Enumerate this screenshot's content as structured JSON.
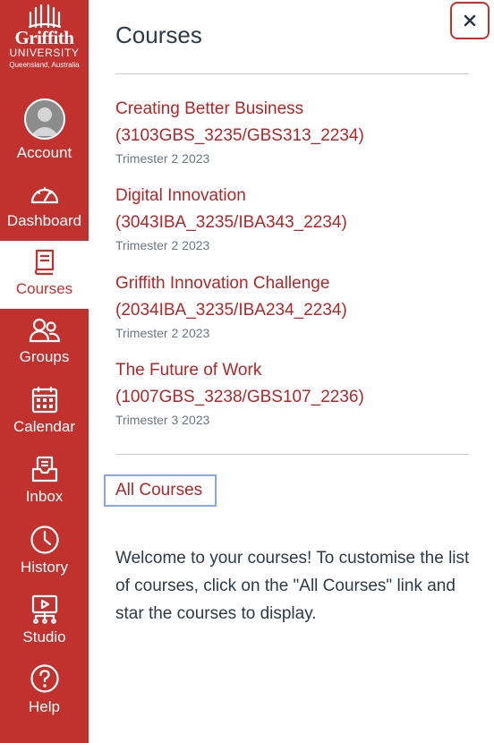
{
  "brand": {
    "name": "Griffith",
    "university": "UNIVERSITY",
    "location": "Queensland, Australia",
    "color": "#c1322f"
  },
  "nav": {
    "items": [
      {
        "id": "account",
        "label": "Account",
        "icon": "avatar",
        "active": false
      },
      {
        "id": "dashboard",
        "label": "Dashboard",
        "icon": "speedometer-icon",
        "active": false
      },
      {
        "id": "courses",
        "label": "Courses",
        "icon": "book-icon",
        "active": true
      },
      {
        "id": "groups",
        "label": "Groups",
        "icon": "people-icon",
        "active": false
      },
      {
        "id": "calendar",
        "label": "Calendar",
        "icon": "calendar-icon",
        "active": false
      },
      {
        "id": "inbox",
        "label": "Inbox",
        "icon": "inbox-icon",
        "active": false
      },
      {
        "id": "history",
        "label": "History",
        "icon": "clock-icon",
        "active": false
      },
      {
        "id": "studio",
        "label": "Studio",
        "icon": "studio-icon",
        "active": false
      },
      {
        "id": "help",
        "label": "Help",
        "icon": "help-icon",
        "active": false
      }
    ]
  },
  "tray": {
    "title": "Courses",
    "close_icon": "close-icon",
    "courses": [
      {
        "name_line1": "Creating Better Business",
        "name_line2": "(3103GBS_3235/GBS313_2234)",
        "term": "Trimester 2 2023"
      },
      {
        "name_line1": "Digital Innovation",
        "name_line2": "(3043IBA_3235/IBA343_2234)",
        "term": "Trimester 2 2023"
      },
      {
        "name_line1": "Griffith Innovation Challenge",
        "name_line2": "(2034IBA_3235/IBA234_2234)",
        "term": "Trimester 2 2023"
      },
      {
        "name_line1": "The Future of Work",
        "name_line2": "(1007GBS_3238/GBS107_2236)",
        "term": "Trimester 3 2023"
      }
    ],
    "all_courses_label": "All Courses",
    "welcome_text": "Welcome to your courses! To customise the list of courses, click on the \"All Courses\" link and star the courses to display."
  },
  "colors": {
    "link": "#b0282a",
    "text": "#2d3b45",
    "muted": "#6b7780",
    "focus_ring": "#8aa7e0"
  }
}
